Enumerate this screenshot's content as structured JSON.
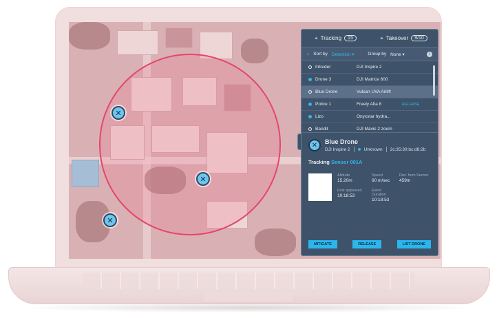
{
  "panel": {
    "tabs": [
      {
        "label": "Tracking",
        "count": "15"
      },
      {
        "label": "Takeover",
        "count": "9/10"
      }
    ],
    "sort": {
      "label": "Sort by",
      "value": "Detection"
    },
    "group": {
      "label": "Group by",
      "value": "None"
    },
    "info_icon": "i",
    "rows": [
      {
        "name": "Intruder",
        "model": "DJI Inspire 2",
        "action": ""
      },
      {
        "name": "Drone 3",
        "model": "DJI Matrice 600",
        "action": ""
      },
      {
        "name": "Blue Drone",
        "model": "Vulcan UVA Airlift",
        "action": ""
      },
      {
        "name": "Police 1",
        "model": "Freely Alta 8",
        "action": "RELEASE"
      },
      {
        "name": "Lizo",
        "model": "Onyxstar hydra...",
        "action": ""
      },
      {
        "name": "Bandit",
        "model": "DJI Mavic 2 zoom",
        "action": ""
      }
    ],
    "detail": {
      "title": "Blue Drone",
      "model": "DJI Inspire 2",
      "status": "Unknown",
      "mac": "2c:35:30:bc:d8:2b",
      "tracking_label": "Tracking",
      "tracking_sensor": "Sensor 001A",
      "stats": [
        {
          "label": "Altitude",
          "value": "15.20m"
        },
        {
          "label": "Speed",
          "value": "60 m/sec"
        },
        {
          "label": "Dist. from Sensor",
          "value": "459m"
        },
        {
          "label": "First appeared",
          "value": "10:18:53"
        },
        {
          "label": "Event Duration",
          "value": "10:18:53"
        }
      ],
      "buttons": {
        "mitigate": "MITIGATE",
        "release": "RELEASE",
        "list": "LIST DRONE"
      }
    }
  },
  "colors": {
    "accent": "#31b8ec",
    "zone": "#e5466b",
    "panel": "#3e5269"
  }
}
